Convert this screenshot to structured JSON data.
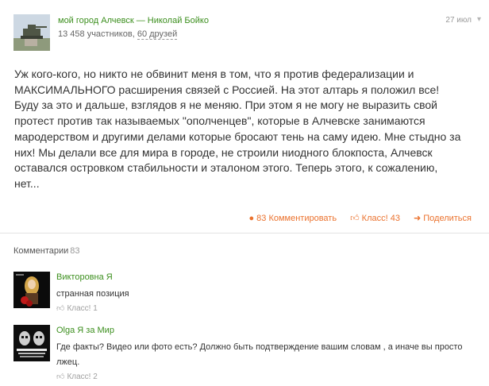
{
  "post": {
    "group_name": "мой город Алчевск",
    "separator": "—",
    "author": "Николай Бойко",
    "members": "13 458 участников,",
    "friends": "60 друзей",
    "date": "27 июл",
    "menu_icon": "chevron-down-icon",
    "text_lines": [
      "Уж кого-кого, но никто не обвинит меня в том, что я против федерализации и",
      "МАКСИМАЛЬНОГО расширения связей с Россией. На этот алтарь я положил все!",
      "Буду за это и дальше, взглядов я не меняю. При этом я не могу не выразить свой",
      "протест против так называемых \"ополченцев\", которые в Алчевске занимаются",
      "мародерством и другими делами которые бросают тень на саму идею. Мне стыдно за",
      "них! Мы делали все для мира в городе, не строили ниодного блокпоста, Алчевск",
      "оставался островком стабильности и эталоном этого. Теперь этого, к сожалению,",
      "нет..."
    ],
    "actions": {
      "comment_count": "83",
      "comment_label": "Комментировать",
      "like_label": "Класс!",
      "like_count": "43",
      "share_label": "Поделиться"
    },
    "accent_color": "#eb722e",
    "link_color": "#3c8f1e"
  },
  "comments": {
    "title": "Комментарии",
    "count": "83",
    "items": [
      {
        "author": "Викторовна Я",
        "text_lines": [
          "странная позиция"
        ],
        "like_label": "Класс!",
        "like_count": "1"
      },
      {
        "author": "Olga Я за Мир",
        "text_lines": [
          "Где факты? Видео или фото есть? Должно быть подтверждение вашим словам , а иначе вы просто",
          "лжец."
        ],
        "like_label": "Класс!",
        "like_count": "2"
      }
    ]
  }
}
